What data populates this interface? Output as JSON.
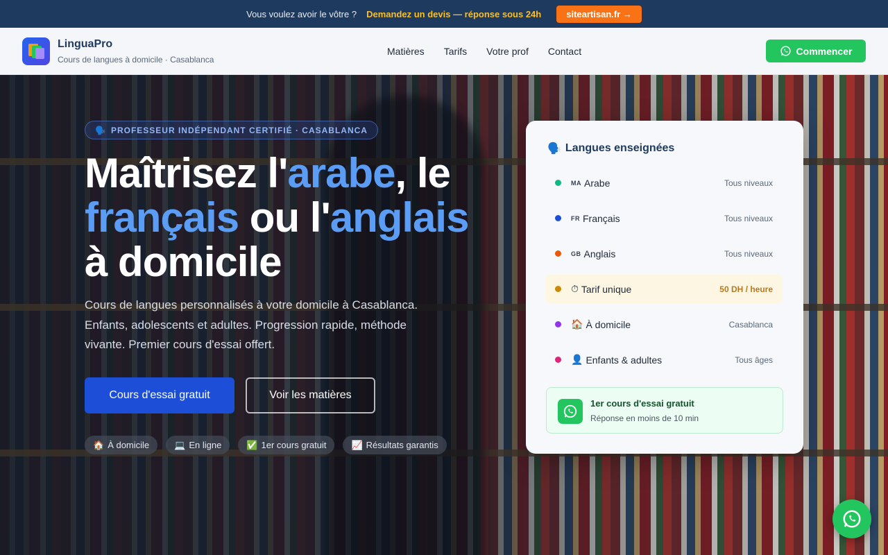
{
  "topbar": {
    "text": "Vous voulez avoir le vôtre ?",
    "cta": "Demandez un devis — réponse sous 24h",
    "button": "siteartisan.fr →"
  },
  "header": {
    "brand": "LinguaPro",
    "tagline": "Cours de langues à domicile · Casablanca",
    "nav": [
      "Matières",
      "Tarifs",
      "Votre prof",
      "Contact"
    ],
    "cta": "Commencer"
  },
  "hero": {
    "badge": "PROFESSEUR INDÉPENDANT CERTIFIÉ · CASABLANCA",
    "title_parts": [
      "Maîtrisez l'",
      "arabe",
      ", le",
      "français",
      " ou l'",
      "anglais",
      "à domicile"
    ],
    "lead": "Cours de langues personnalisés à votre domicile à Casablanca. Enfants, adolescents et adultes. Progression rapide, méthode vivante. Premier cours d'essai offert.",
    "primary_button": "Cours d'essai gratuit",
    "secondary_button": "Voir les matières",
    "chips": [
      {
        "icon": "🏠",
        "label": "À domicile"
      },
      {
        "icon": "💻",
        "label": "En ligne"
      },
      {
        "icon": "✅",
        "label": "1er cours gratuit"
      },
      {
        "icon": "📈",
        "label": "Résultats garantis"
      }
    ]
  },
  "card": {
    "title_icon": "🗣️",
    "title": "Langues enseignées",
    "rows": [
      {
        "flag": "MA",
        "icon": "",
        "label": "Arabe",
        "value": "Tous niveaux",
        "dot": "#10b981"
      },
      {
        "flag": "FR",
        "icon": "",
        "label": "Français",
        "value": "Tous niveaux",
        "dot": "#1d4ed8"
      },
      {
        "flag": "GB",
        "icon": "",
        "label": "Anglais",
        "value": "Tous niveaux",
        "dot": "#ea580c"
      },
      {
        "flag": "",
        "icon": "⏱",
        "label": "Tarif unique",
        "value": "50 DH / heure",
        "dot": "#ca8a04"
      },
      {
        "flag": "",
        "icon": "🏠",
        "label": "À domicile",
        "value": "Casablanca",
        "dot": "#9333ea"
      },
      {
        "flag": "",
        "icon": "👤",
        "label": "Enfants & adultes",
        "value": "Tous âges",
        "dot": "#db2777"
      }
    ],
    "promo_title": "1er cours d'essai gratuit",
    "promo_sub": "Réponse en moins de 10 min"
  }
}
